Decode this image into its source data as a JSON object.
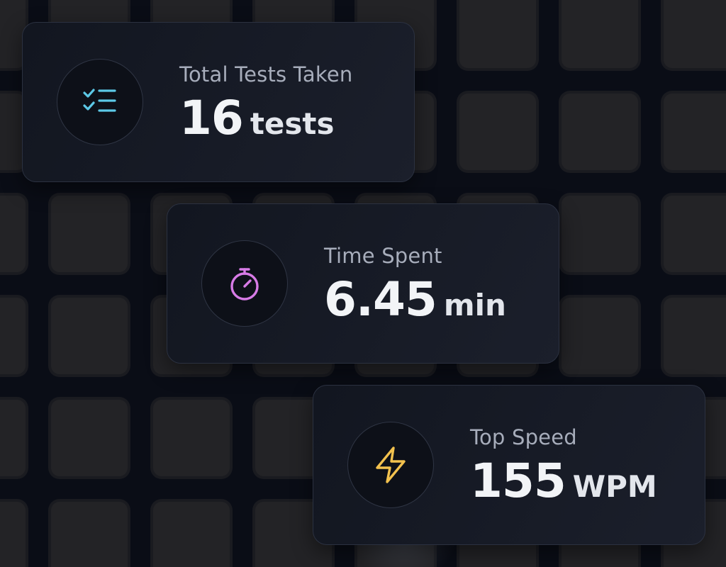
{
  "stats": [
    {
      "label": "Total Tests Taken",
      "value": "16",
      "unit": "tests",
      "icon": "checklist-icon",
      "accent": "#5cc8e6"
    },
    {
      "label": "Time Spent",
      "value": "6.45",
      "unit": "min",
      "icon": "stopwatch-icon",
      "accent": "#d77be6"
    },
    {
      "label": "Top Speed",
      "value": "155",
      "unit": "WPM",
      "icon": "lightning-icon",
      "accent": "#f2c14e"
    }
  ]
}
